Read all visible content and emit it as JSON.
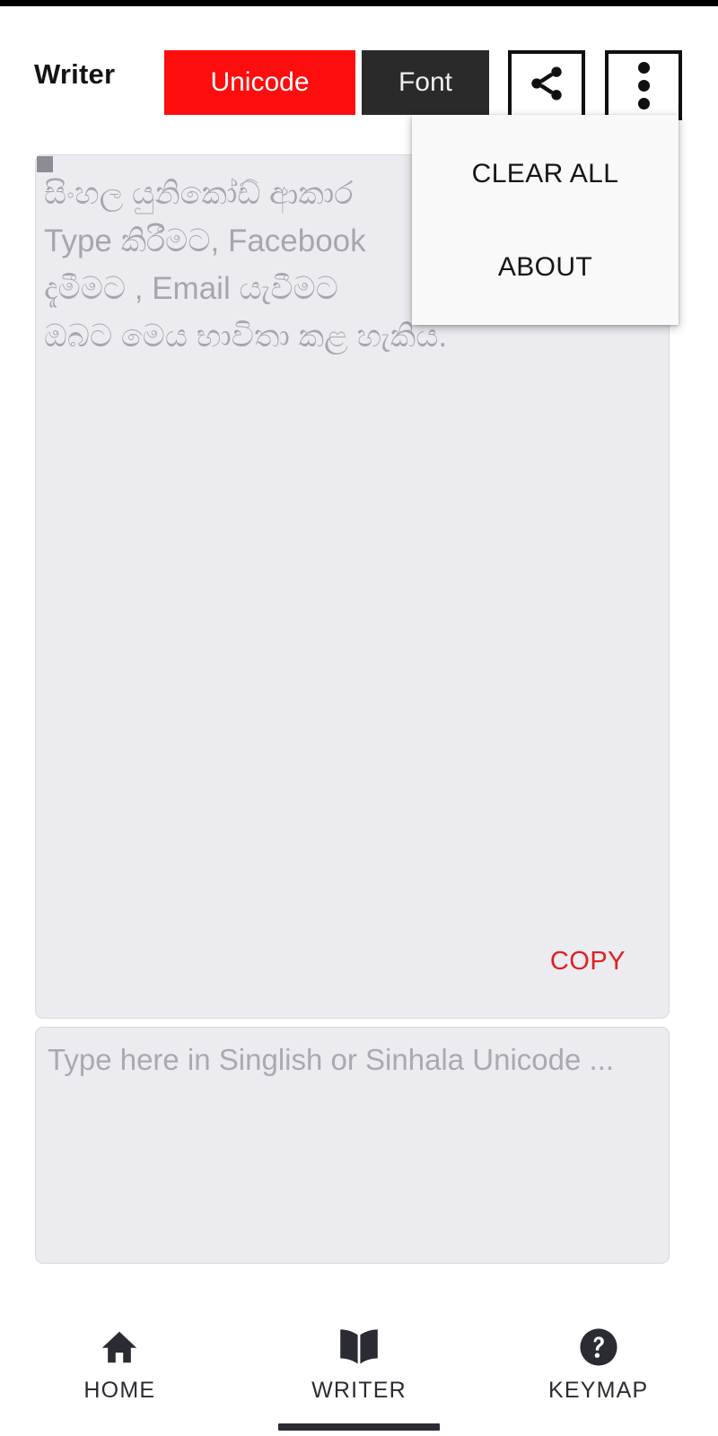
{
  "app": {
    "title": "Writer"
  },
  "toolbar": {
    "unicode_label": "Unicode",
    "font_label": "Font",
    "share_icon": "share-icon",
    "overflow_icon": "more-vertical-icon"
  },
  "dropdown": {
    "items": [
      {
        "label": "CLEAR ALL"
      },
      {
        "label": "ABOUT"
      }
    ]
  },
  "display": {
    "lines": [
      "සිංහල යුනිකෝඩ් ආකාර",
      "Type කිරීමට, Facebook",
      "දැමීමට , Email යැවීමට",
      "ඔබට මෙය භාවිතා කළ හැකිය."
    ],
    "copy_label": "COPY"
  },
  "input": {
    "placeholder": "Type here in Singlish or Sinhala Unicode ...",
    "value": ""
  },
  "bottom_nav": {
    "items": [
      {
        "label": "HOME",
        "icon": "home-icon",
        "active": false
      },
      {
        "label": "WRITER",
        "icon": "book-icon",
        "active": true
      },
      {
        "label": "KEYMAP",
        "icon": "help-circle-icon",
        "active": false
      }
    ]
  },
  "colors": {
    "accent_red": "#fd0d0d",
    "dark": "#2a2a2a",
    "copy_red": "#e02020",
    "field_bg": "#ececf0"
  }
}
